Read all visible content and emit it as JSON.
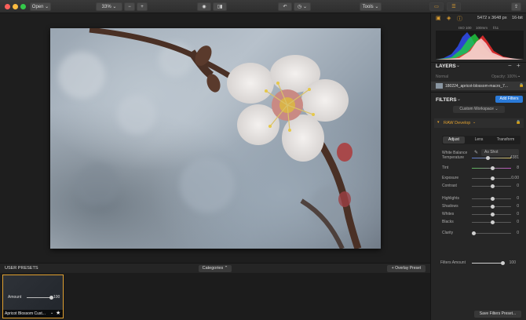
{
  "toolbar": {
    "open_label": "Open",
    "zoom": "33%",
    "tools_label": "Tools"
  },
  "image_info": {
    "dimensions": "5472 x 3648 px",
    "bit_depth": "16-bit",
    "iso": "ISO 100",
    "focal": "100mm",
    "aperture": "f/11"
  },
  "layers": {
    "title": "LAYERS",
    "blend": "Normal",
    "opacity": "Opacity: 100%",
    "layer_name": "180224_apricot-blossom-macro_7..."
  },
  "filters": {
    "title": "FILTERS",
    "add_label": "Add Filters",
    "workspace": "Custom Workspace",
    "raw_title": "RAW Develop",
    "tabs": [
      "Adjust",
      "Lens",
      "Transform"
    ],
    "white_balance_label": "White Balance",
    "white_balance_value": "As Shot",
    "sliders": [
      {
        "label": "Temperature",
        "value": "4381",
        "pos": 0.38
      },
      {
        "label": "Tint",
        "value": "8",
        "pos": 0.52
      },
      {
        "label": "Exposure",
        "value": "0.00",
        "pos": 0.5
      },
      {
        "label": "Contrast",
        "value": "0",
        "pos": 0.5
      },
      {
        "label": "Highlights",
        "value": "0",
        "pos": 0.5
      },
      {
        "label": "Shadows",
        "value": "0",
        "pos": 0.5
      },
      {
        "label": "Whites",
        "value": "0",
        "pos": 0.5
      },
      {
        "label": "Blacks",
        "value": "0",
        "pos": 0.5
      },
      {
        "label": "Clarity",
        "value": "0",
        "pos": 0.0
      }
    ],
    "amount_label": "Filters Amount",
    "amount_value": "100",
    "save_label": "Save Filters Preset..."
  },
  "presets": {
    "title": "USER PRESETS",
    "categories": "Categories",
    "overlay": "+ Overlay Preset",
    "amount_label": "Amount",
    "amount_value": "100",
    "preset_name": "Apricot Blossom Cust..."
  }
}
